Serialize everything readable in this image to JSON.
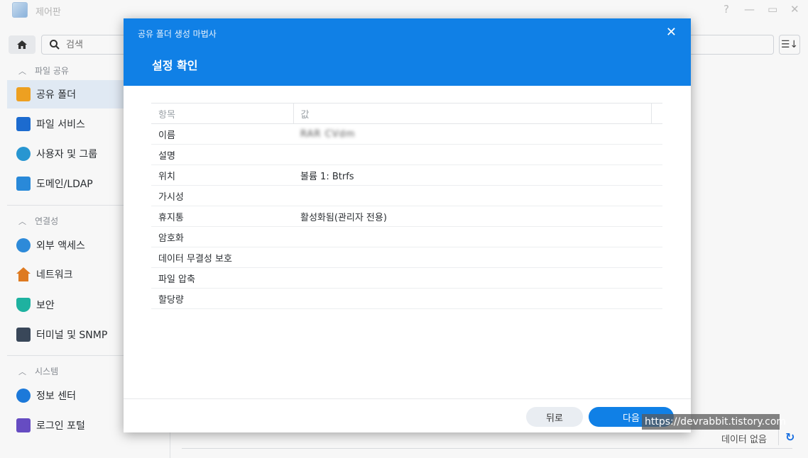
{
  "window": {
    "title": "제어판",
    "controls": {
      "help": "?",
      "minimize": "—",
      "maximize": "▭",
      "close": "✕"
    }
  },
  "toolbar": {
    "search_placeholder": "검색"
  },
  "sidebar": {
    "sections": [
      {
        "header": "파일 공유",
        "items": [
          {
            "label": "공유 폴더",
            "icon": "shared-folder-icon",
            "active": true
          },
          {
            "label": "파일 서비스",
            "icon": "file-services-icon"
          },
          {
            "label": "사용자 및 그룹",
            "icon": "users-groups-icon"
          },
          {
            "label": "도메인/LDAP",
            "icon": "domain-ldap-icon"
          }
        ]
      },
      {
        "header": "연결성",
        "items": [
          {
            "label": "외부 액세스",
            "icon": "external-access-icon"
          },
          {
            "label": "네트워크",
            "icon": "network-icon"
          },
          {
            "label": "보안",
            "icon": "security-shield-icon"
          },
          {
            "label": "터미널 및 SNMP",
            "icon": "terminal-icon"
          }
        ]
      },
      {
        "header": "시스템",
        "items": [
          {
            "label": "정보 센터",
            "icon": "info-center-icon"
          },
          {
            "label": "로그인 포털",
            "icon": "login-portal-icon"
          }
        ]
      }
    ]
  },
  "status": {
    "text": "데이터 없음"
  },
  "modal": {
    "wizard_title": "공유 폴더 생성 마법사",
    "step_title": "설정 확인",
    "columns": [
      "항목",
      "값"
    ],
    "rows": [
      {
        "item": "이름",
        "value": "RAR CVdm"
      },
      {
        "item": "설명",
        "value": ""
      },
      {
        "item": "위치",
        "value": "볼륨 1: Btrfs"
      },
      {
        "item": "가시성",
        "value": ""
      },
      {
        "item": "휴지통",
        "value": "활성화됨(관리자 전용)"
      },
      {
        "item": "암호화",
        "value": ""
      },
      {
        "item": "데이터 무결성 보호",
        "value": ""
      },
      {
        "item": "파일 압축",
        "value": ""
      },
      {
        "item": "할당량",
        "value": ""
      }
    ],
    "back_label": "뒤로",
    "next_label": "다음"
  },
  "watermark": "https://devrabbit.tistory.com",
  "colors": {
    "accent": "#1080e6",
    "active_bg": "#e8f1fb"
  }
}
